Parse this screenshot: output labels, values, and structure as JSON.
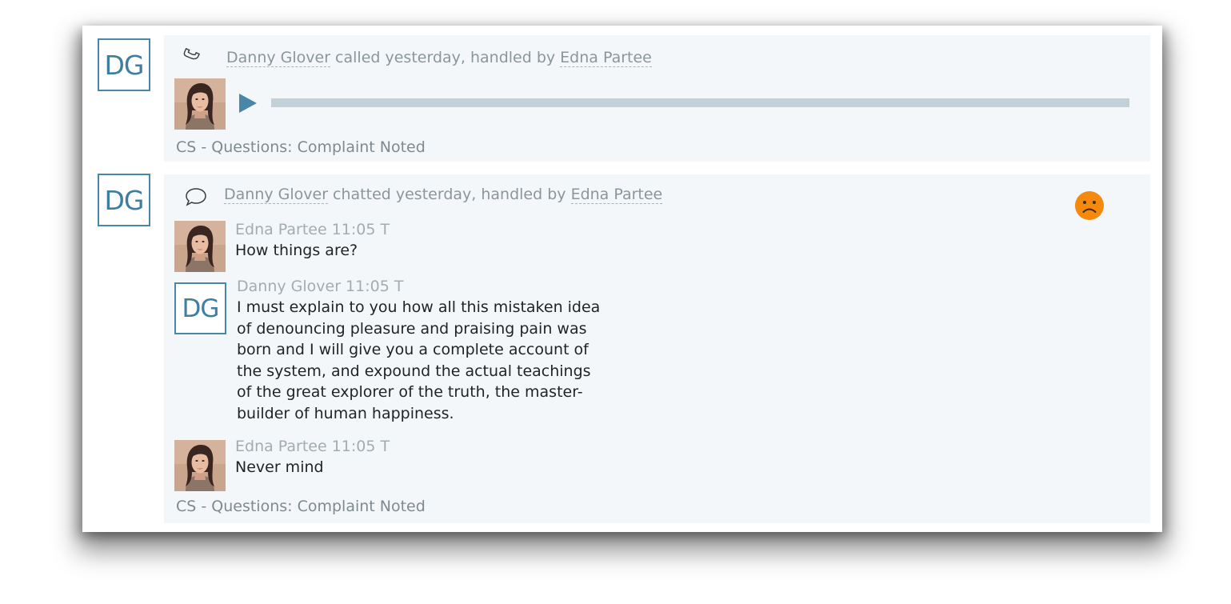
{
  "items": [
    {
      "type": "call",
      "avatar_initials": "DG",
      "icon": "phone-icon",
      "customer": "Danny Glover",
      "action_text": " called yesterday, handled by ",
      "agent": "Edna Partee",
      "player": {
        "icon": "play-icon",
        "progress": 0
      },
      "tag": "CS - Questions: Complaint Noted"
    },
    {
      "type": "chat",
      "avatar_initials": "DG",
      "icon": "chat-bubble-icon",
      "customer": "Danny Glover",
      "action_text": " chatted yesterday, handled by ",
      "agent": "Edna Partee",
      "sentiment": {
        "icon": "sad-face-icon",
        "value": "negative",
        "color": "#f5890d"
      },
      "messages": [
        {
          "author": "Edna Partee",
          "time": "11:05 T",
          "meta": "Edna Partee 11:05 T",
          "avatar": "agent-photo",
          "text": "How things are?"
        },
        {
          "author": "Danny Glover",
          "time": "11:05 T",
          "meta": "Danny Glover 11:05 T",
          "avatar": "DG",
          "text_lines": [
            "I must explain to you how all this mistaken idea",
            "of denouncing pleasure and praising pain was",
            "born and I will give you a complete account of",
            "the system, and expound the actual teachings",
            "of the great explorer of the truth, the master-",
            "builder of human happiness."
          ]
        },
        {
          "author": "Edna Partee",
          "time": "11:05 T",
          "meta": "Edna Partee 11:05 T",
          "avatar": "agent-photo",
          "text": "Never mind"
        }
      ],
      "tag": "CS - Questions: Complaint Noted"
    }
  ],
  "colors": {
    "accent": "#4a86a8",
    "card_bg": "#f3f7f9",
    "progress_track": "#c2d1d8",
    "sentiment_negative": "#f5890d"
  }
}
